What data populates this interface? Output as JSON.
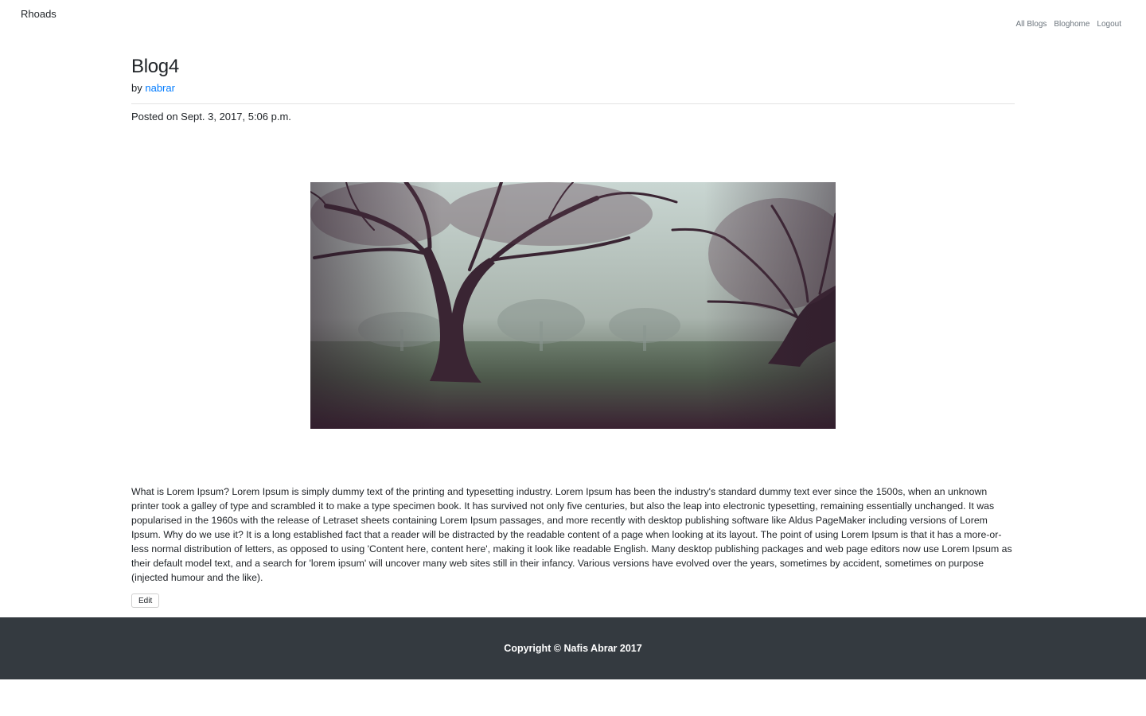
{
  "header": {
    "brand": "Rhoads",
    "nav": [
      {
        "label": "All Blogs"
      },
      {
        "label": "Bloghome"
      },
      {
        "label": "Logout"
      }
    ]
  },
  "post": {
    "title": "Blog4",
    "by_prefix": "by",
    "author": "nabrar",
    "posted": "Posted on Sept. 3, 2017, 5:06 p.m.",
    "image_alt": "foggy-field-trees-photo",
    "body": "What is Lorem Ipsum? Lorem Ipsum is simply dummy text of the printing and typesetting industry. Lorem Ipsum has been the industry's standard dummy text ever since the 1500s, when an unknown printer took a galley of type and scrambled it to make a type specimen book. It has survived not only five centuries, but also the leap into electronic typesetting, remaining essentially unchanged. It was popularised in the 1960s with the release of Letraset sheets containing Lorem Ipsum passages, and more recently with desktop publishing software like Aldus PageMaker including versions of Lorem Ipsum. Why do we use it? It is a long established fact that a reader will be distracted by the readable content of a page when looking at its layout. The point of using Lorem Ipsum is that it has a more-or-less normal distribution of letters, as opposed to using 'Content here, content here', making it look like readable English. Many desktop publishing packages and web page editors now use Lorem Ipsum as their default model text, and a search for 'lorem ipsum' will uncover many web sites still in their infancy. Various versions have evolved over the years, sometimes by accident, sometimes on purpose (injected humour and the like).",
    "edit_label": "Edit"
  },
  "footer": {
    "copyright": "Copyright © Nafis Abrar 2017"
  },
  "colors": {
    "link": "#007bff",
    "footer_bg": "#343a40",
    "nav_text": "#6c757d"
  }
}
